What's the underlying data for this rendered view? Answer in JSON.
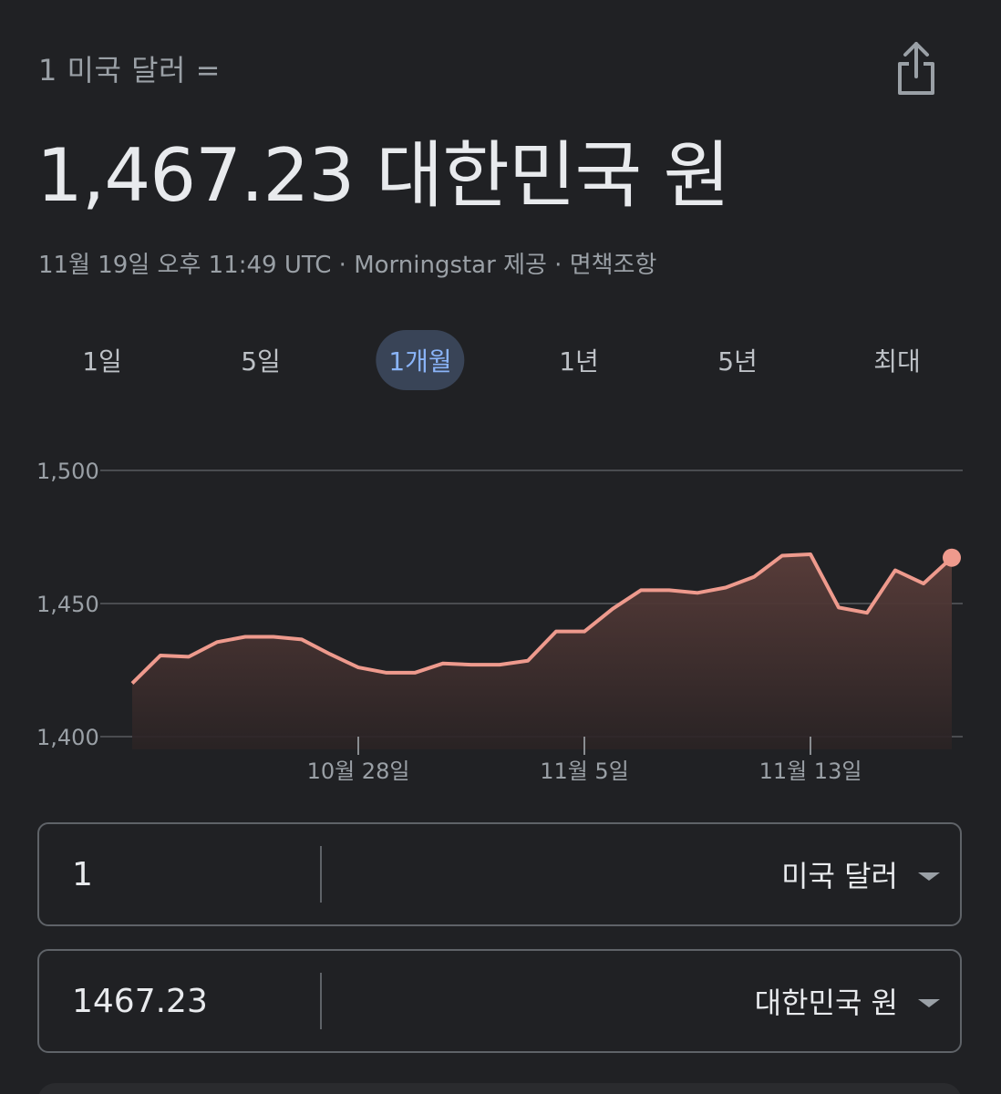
{
  "header": {
    "subtitle": "1 미국 달러 =",
    "main_value": "1,467.23 대한민국 원",
    "meta_time": "11월 19일 오후 11:49 UTC",
    "meta_sep1": " · ",
    "meta_source": "Morningstar 제공",
    "meta_sep2": " · ",
    "meta_disclaimer": "면책조항"
  },
  "share": {
    "icon": "share-icon"
  },
  "tabs": [
    {
      "label": "1일",
      "active": false
    },
    {
      "label": "5일",
      "active": false
    },
    {
      "label": "1개월",
      "active": true
    },
    {
      "label": "1년",
      "active": false
    },
    {
      "label": "5년",
      "active": false
    },
    {
      "label": "최대",
      "active": false
    }
  ],
  "chart_data": {
    "type": "area",
    "y_ticks": [
      "1,500",
      "1,450",
      "1,400"
    ],
    "y_tick_values": [
      1500,
      1450,
      1400
    ],
    "ylim": [
      1400,
      1500
    ],
    "x_labels": [
      "10월 28일",
      "11월 5일",
      "11월 13일"
    ],
    "x_label_indices": [
      8,
      16,
      24
    ],
    "x": [
      1,
      2,
      3,
      4,
      5,
      6,
      7,
      8,
      9,
      10,
      11,
      12,
      13,
      14,
      15,
      16,
      17,
      18,
      19,
      20,
      21,
      22,
      23,
      24,
      25,
      26,
      27,
      28,
      29,
      30
    ],
    "values": [
      1420,
      1430.5,
      1430,
      1435.5,
      1437.5,
      1437.5,
      1436.5,
      1431,
      1426,
      1424,
      1424,
      1427.5,
      1427,
      1427,
      1428.5,
      1439.5,
      1439.5,
      1448,
      1455,
      1455,
      1454,
      1456,
      1460,
      1468,
      1468.5,
      1448.5,
      1446.5,
      1462.5,
      1457.5,
      1467.23
    ],
    "line_color": "#ee9a8d",
    "fill_color": "#4a3533",
    "grid": true
  },
  "converter": {
    "from_amount": "1",
    "from_currency": "미국 달러",
    "to_amount": "1467.23",
    "to_currency": "대한민국 원"
  }
}
